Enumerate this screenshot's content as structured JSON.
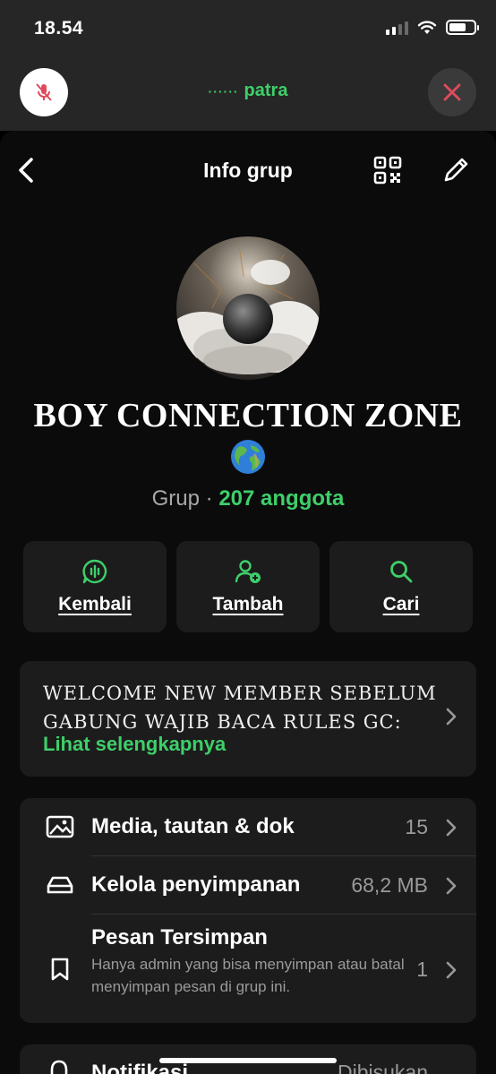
{
  "status_bar": {
    "time": "18.54"
  },
  "call": {
    "name": "patra"
  },
  "colors": {
    "accent": "#3ecf6a",
    "danger": "#e04b5c"
  },
  "nav": {
    "title": "Info grup"
  },
  "group": {
    "name": "BOY CONNECTION ZONE",
    "type_label": "Grup",
    "separator": " · ",
    "members": "207 anggota"
  },
  "actions": [
    {
      "label": "Kembali",
      "icon": "audio-wave-icon"
    },
    {
      "label": "Tambah",
      "icon": "add-person-icon"
    },
    {
      "label": "Cari",
      "icon": "search-icon"
    }
  ],
  "description": {
    "line1": "WELCOME NEW MEMBER SEBELUM",
    "line2": "GABUNG WAJIB BACA RULES GC:",
    "more": "Lihat selengkapnya"
  },
  "list": {
    "media": {
      "label": "Media, tautan & dok",
      "value": "15"
    },
    "storage": {
      "label": "Kelola penyimpanan",
      "value": "68,2 MB"
    },
    "saved": {
      "label": "Pesan Tersimpan",
      "subtitle": "Hanya admin yang bisa menyimpan atau batal menyimpan pesan di grup ini.",
      "value": "1"
    }
  },
  "notifications": {
    "label": "Notifikasi",
    "value": "Dibisukan"
  }
}
